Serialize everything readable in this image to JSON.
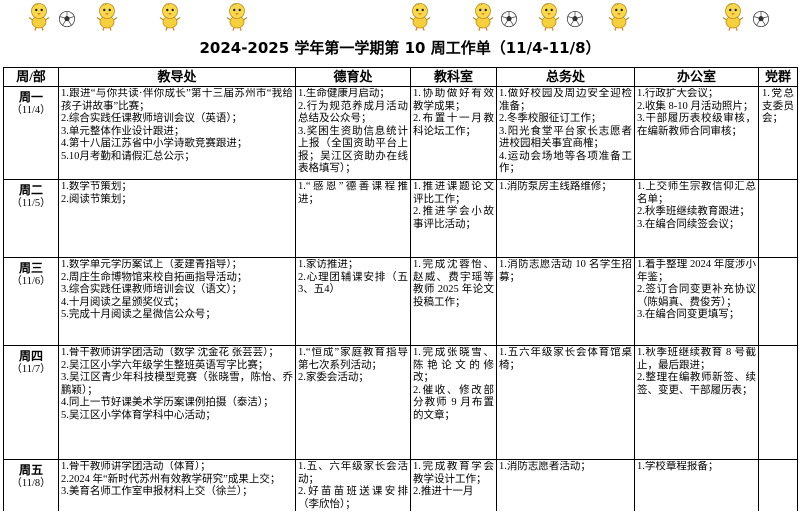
{
  "title": "2024-2025 学年第一学期第 10 周工作单（11/4-11/8）",
  "headers": [
    "周/部",
    "教导处",
    "德育处",
    "教科室",
    "总务处",
    "办公室",
    "党群"
  ],
  "decor_icons": {
    "mascot": "chick-mascot-icon",
    "ball": "soccer-ball-icon"
  },
  "colors": {
    "grid": "#000000",
    "mascot": "#f8d84e",
    "mascot_beak": "#e57d21"
  },
  "rows": [
    {
      "day": "周一",
      "date": "（11/4）",
      "jiaodao": [
        "1.跟进“与你共读·伴你成长”第十三届苏州市“我给孩子讲故事”比赛；",
        "2.综合实践任课教师培训会议（英语）；",
        "3.单元整体作业设计跟进；",
        "4.第十八届江苏省中小学诗歌竞赛跟进；",
        "5.10月考勤和请假汇总公示；"
      ],
      "deyu": [
        "1.生命健康月启动；",
        "2.行为规范养成月活动总结及公众号；",
        "3.奖困生资助信息统计上报（全国资助平台上报；吴江区资助办在线表格填写）；"
      ],
      "jiaoke": [
        "1.协助做好有效教学成果；",
        "2.布置十一月教科论坛工作；"
      ],
      "zongwu": [
        "1.做好校园及周边安全迎检准备；",
        "2.冬季校服征订工作；",
        "3.阳光食堂平台家长志愿者进校园相关事宜商榷；",
        "4.运动会场地等各项准备工作；"
      ],
      "bangong": [
        "1.行政扩大会议；",
        "2.收集 8-10 月活动照片；",
        "3.干部履历表校级审核，在编新教师合同审核；"
      ],
      "dangqun": [
        "1.党总支委员会；"
      ]
    },
    {
      "day": "周二",
      "date": "（11/5）",
      "jiaodao": [
        "1.数学节策划；",
        "2.阅读节策划；"
      ],
      "deyu": [
        "1.“感恩”德善课程推进；"
      ],
      "jiaoke": [
        "1.推进课题论文评比工作；",
        "2.推进学会小故事评比活动；"
      ],
      "zongwu": [
        "1.消防泵房主线路维修；"
      ],
      "bangong": [
        "1.上交师生宗教信仰汇总名单；",
        "2.秋季班继续教育跟进；",
        "3.在编合同续签会议；"
      ],
      "dangqun": []
    },
    {
      "day": "周三",
      "date": "（11/6）",
      "jiaodao": [
        "1.数学单元学历案试上（麦建青指导）；",
        "2.周庄生命博物馆来校自拓画指导活动；",
        "3.综合实践任课教师培训会议（语文）；",
        "4.十月阅读之星颁奖仪式；",
        "5.完成十月阅读之星微信公众号；"
      ],
      "deyu": [
        "1.家访推进；",
        "2.心理团辅课安排（五3、五4）"
      ],
      "jiaoke": [
        "1.完成沈蓉怡、赵威、费宇瑶等教师 2025 年论文投稿工作；"
      ],
      "zongwu": [
        "1.消防志愿活动 10 名学生招募；"
      ],
      "bangong": [
        "1.着手整理 2024 年度涉小年鉴；",
        "2.签订合同变更补充协议（陈娟真、费俊芳）；",
        "3.在编合同变更填写；"
      ],
      "dangqun": []
    },
    {
      "day": "周四",
      "date": "（11/7）",
      "jiaodao": [
        "1.骨干教师讲学团活动（数学 沈金花 张芸芸）；",
        "2.吴江区小学六年级学生整班英语写字比赛；",
        "3.吴江区青少年科技模型竞赛（张晓雪，陈怡、乔鹏颖）；",
        "4.同上一节好课美术学历案课例拍摄（泰洁）；",
        "5.吴江区小学体育学科中心活动；"
      ],
      "deyu": [
        "1.“恒成”家庭教育指导第七次系列活动；",
        "2.家委会活动；"
      ],
      "jiaoke": [
        "1.完成张晓雪、陈艳论文的修改；",
        "2.催收、修改部分教师 9 月布置的文章；"
      ],
      "zongwu": [
        "1.五六年级家长会体育馆桌椅；"
      ],
      "bangong": [
        "1.秋季班继续教育 8 号截止，最后跟进；",
        "2.整理在编教师新签、续签、变更、干部履历表；"
      ],
      "dangqun": []
    },
    {
      "day": "周五",
      "date": "（11/8）",
      "jiaodao": [
        "1.骨干教师讲学团活动（体育）；",
        "2.2024 年“新时代苏州有效教学研究”成果上交；",
        "3.美育名师工作室申报材料上交（徐兰）；"
      ],
      "deyu": [
        "1.五、六年级家长会活动；",
        "2.好苗苗班送课安排（李欣怡）；"
      ],
      "jiaoke": [
        "1.完成教育学会教学设计工作；",
        "2.推进十一月"
      ],
      "zongwu": [
        "1.消防志愿者活动；"
      ],
      "bangong": [
        "1.学校章程报备；"
      ],
      "dangqun": []
    }
  ]
}
